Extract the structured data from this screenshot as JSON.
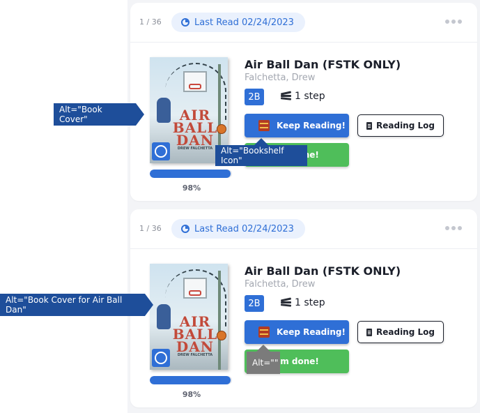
{
  "cards": [
    {
      "counter": "1 / 36",
      "last_read": "Last Read 02/24/2023",
      "cover": {
        "title_lines": [
          "AIR",
          "BALL",
          "DAN"
        ],
        "author": "DREW FALCHETTA"
      },
      "progress": {
        "value": 0.98,
        "label": "98%"
      },
      "title": "Air Ball Dan (FSTK ONLY)",
      "author": "Falchetta, Drew",
      "level": "2B",
      "steps": "1 step",
      "keep_reading": "Keep Reading!",
      "reading_log": "Reading Log",
      "done": "I'm done!"
    },
    {
      "counter": "1 / 36",
      "last_read": "Last Read 02/24/2023",
      "cover": {
        "title_lines": [
          "AIR",
          "BALL",
          "DAN"
        ],
        "author": "DREW FALCHETTA"
      },
      "progress": {
        "value": 0.98,
        "label": "98%"
      },
      "title": "Air Ball Dan (FSTK ONLY)",
      "author": "Falchetta, Drew",
      "level": "2B",
      "steps": "1 step",
      "keep_reading": "Keep Reading!",
      "reading_log": "Reading Log",
      "done": "I'm done!"
    }
  ],
  "annotations": {
    "card1_cover": "Alt=\"Book Cover\"",
    "card1_shelf": "Alt=\"Bookshelf Icon\"",
    "card2_cover": "Alt=\"Book Cover for Air Ball Dan\"",
    "card2_shelf": "Alt=\"\""
  },
  "colors": {
    "accent": "#2f6fd6",
    "done_green": "#4fbe5a",
    "annotation_blue": "#1e4e9a",
    "annotation_grey": "#7b7b7b"
  }
}
